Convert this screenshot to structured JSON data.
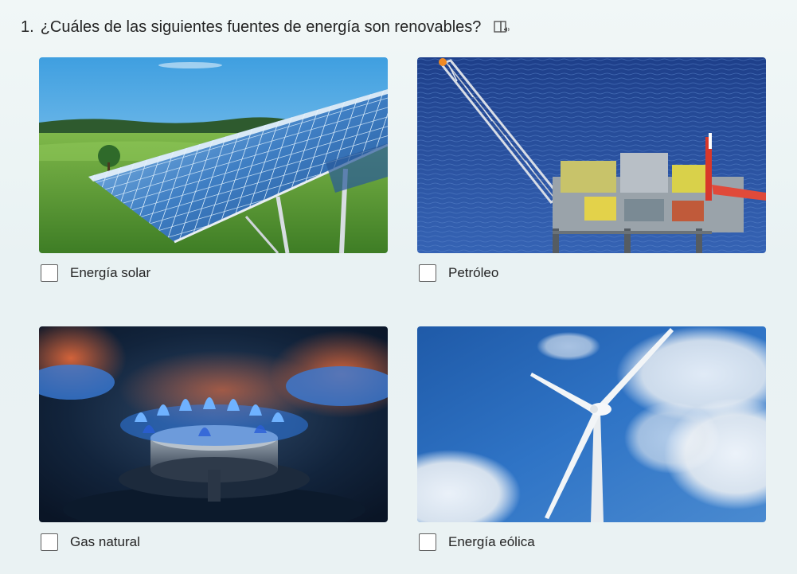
{
  "question": {
    "number": "1.",
    "text": "¿Cuáles de las siguientes fuentes de energía son renovables?",
    "reader_icon": "immersive-reader-icon"
  },
  "options": [
    {
      "label": "Energía solar",
      "image": "solar-panels-photo"
    },
    {
      "label": "Petróleo",
      "image": "oil-platform-photo"
    },
    {
      "label": "Gas natural",
      "image": "gas-burner-photo"
    },
    {
      "label": "Energía eólica",
      "image": "wind-turbine-photo"
    }
  ]
}
